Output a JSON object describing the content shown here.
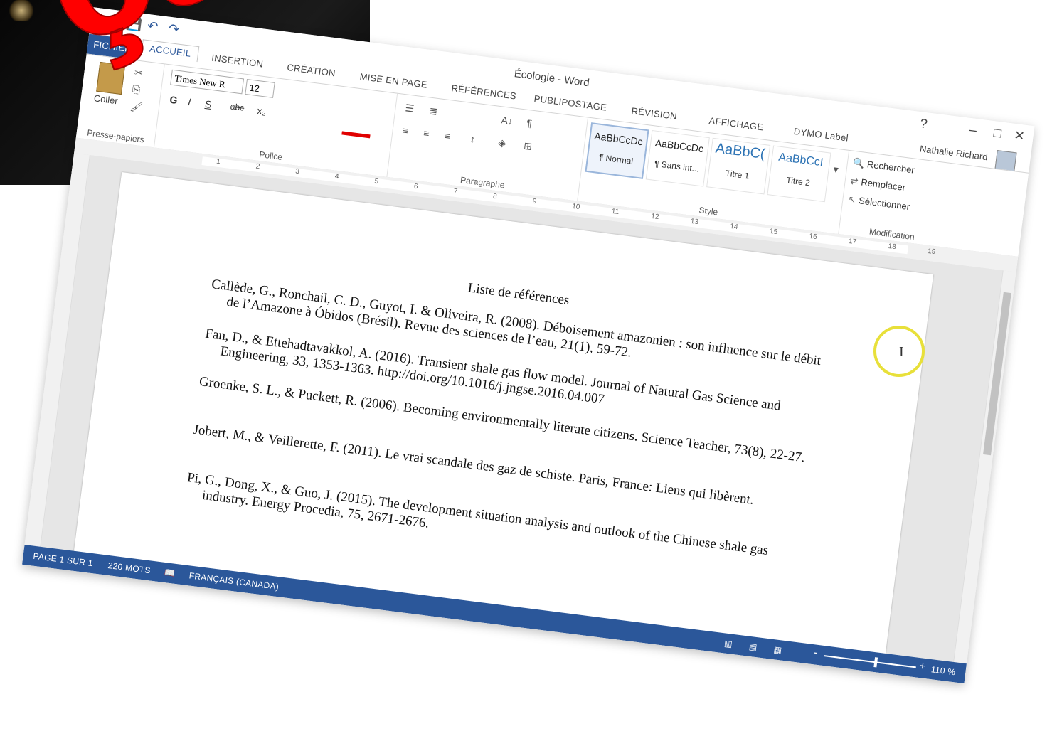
{
  "window": {
    "doc_title": "Écologie - Word",
    "user_name": "Nathalie Richard",
    "help_label": "?",
    "minimize": "–",
    "restore": "□",
    "close": "✕"
  },
  "quick_access": [
    "W",
    "💾",
    "↶",
    "↷"
  ],
  "tabs": [
    "FICHIER",
    "ACCUEIL",
    "INSERTION",
    "CRÉATION",
    "MISE EN PAGE",
    "RÉFÉRENCES",
    "PUBLIPOSTAGE",
    "RÉVISION",
    "AFFICHAGE",
    "DYMO Label"
  ],
  "ribbon": {
    "clipboard": {
      "paste_label": "Coller",
      "group_label": "Presse-papiers"
    },
    "font": {
      "font_name": "Times New R",
      "font_size": "12",
      "bold": "G",
      "italic": "I",
      "underline": "S",
      "strike": "abc",
      "sub": "x₂",
      "group_label": "Police"
    },
    "paragraph": {
      "group_label": "Paragraphe",
      "pilcrow": "¶",
      "sort": "A↓"
    },
    "styles": {
      "group_label": "Style",
      "items": [
        {
          "sample": "AaBbCcDc",
          "name": "¶ Normal"
        },
        {
          "sample": "AaBbCcDc",
          "name": "¶ Sans int..."
        },
        {
          "sample": "AaBbC(",
          "name": "Titre 1"
        },
        {
          "sample": "AaBbCcI",
          "name": "Titre 2"
        }
      ]
    },
    "modification": {
      "group_label": "Modification",
      "find": "Rechercher",
      "replace": "Remplacer",
      "select": "Sélectionner"
    }
  },
  "ruler_ticks": [
    "1",
    "2",
    "3",
    "4",
    "5",
    "6",
    "7",
    "8",
    "9",
    "10",
    "11",
    "12",
    "13",
    "14",
    "15",
    "16",
    "17",
    "18",
    "19"
  ],
  "document": {
    "heading": "Liste de références",
    "references": [
      "Callède, G., Ronchail, C. D., Guyot, I. & Oliveira, R. (2008). Déboisement amazonien : son influence sur le débit de l’Amazone à Óbidos (Brésil). Revue des sciences de l’eau, 21(1), 59-72.",
      "Fan, D., & Ettehadtavakkol, A. (2016). Transient shale gas flow model. Journal of Natural Gas Science and Engineering, 33, 1353-1363. http://doi.org/10.1016/j.jngse.2016.04.007",
      "Groenke, S. L., & Puckett, R. (2006). Becoming environmentally literate citizens. Science Teacher, 73(8), 22-27.",
      "Jobert, M., & Veillerette, F. (2011). Le vrai scandale des gaz de schiste. Paris, France: Liens qui libèrent.",
      "Pi, G., Dong, X., & Guo, J. (2015). The development situation analysis and outlook of the Chinese shale gas industry. Energy Procedia, 75, 2671-2676."
    ]
  },
  "statusbar": {
    "page": "PAGE 1 SUR 1",
    "words": "220 MOTS",
    "language": "FRANÇAIS (CANADA)",
    "zoom_minus": "-",
    "zoom_plus": "+",
    "zoom": "110 %"
  },
  "overlay": {
    "text": "ça sert ?"
  }
}
